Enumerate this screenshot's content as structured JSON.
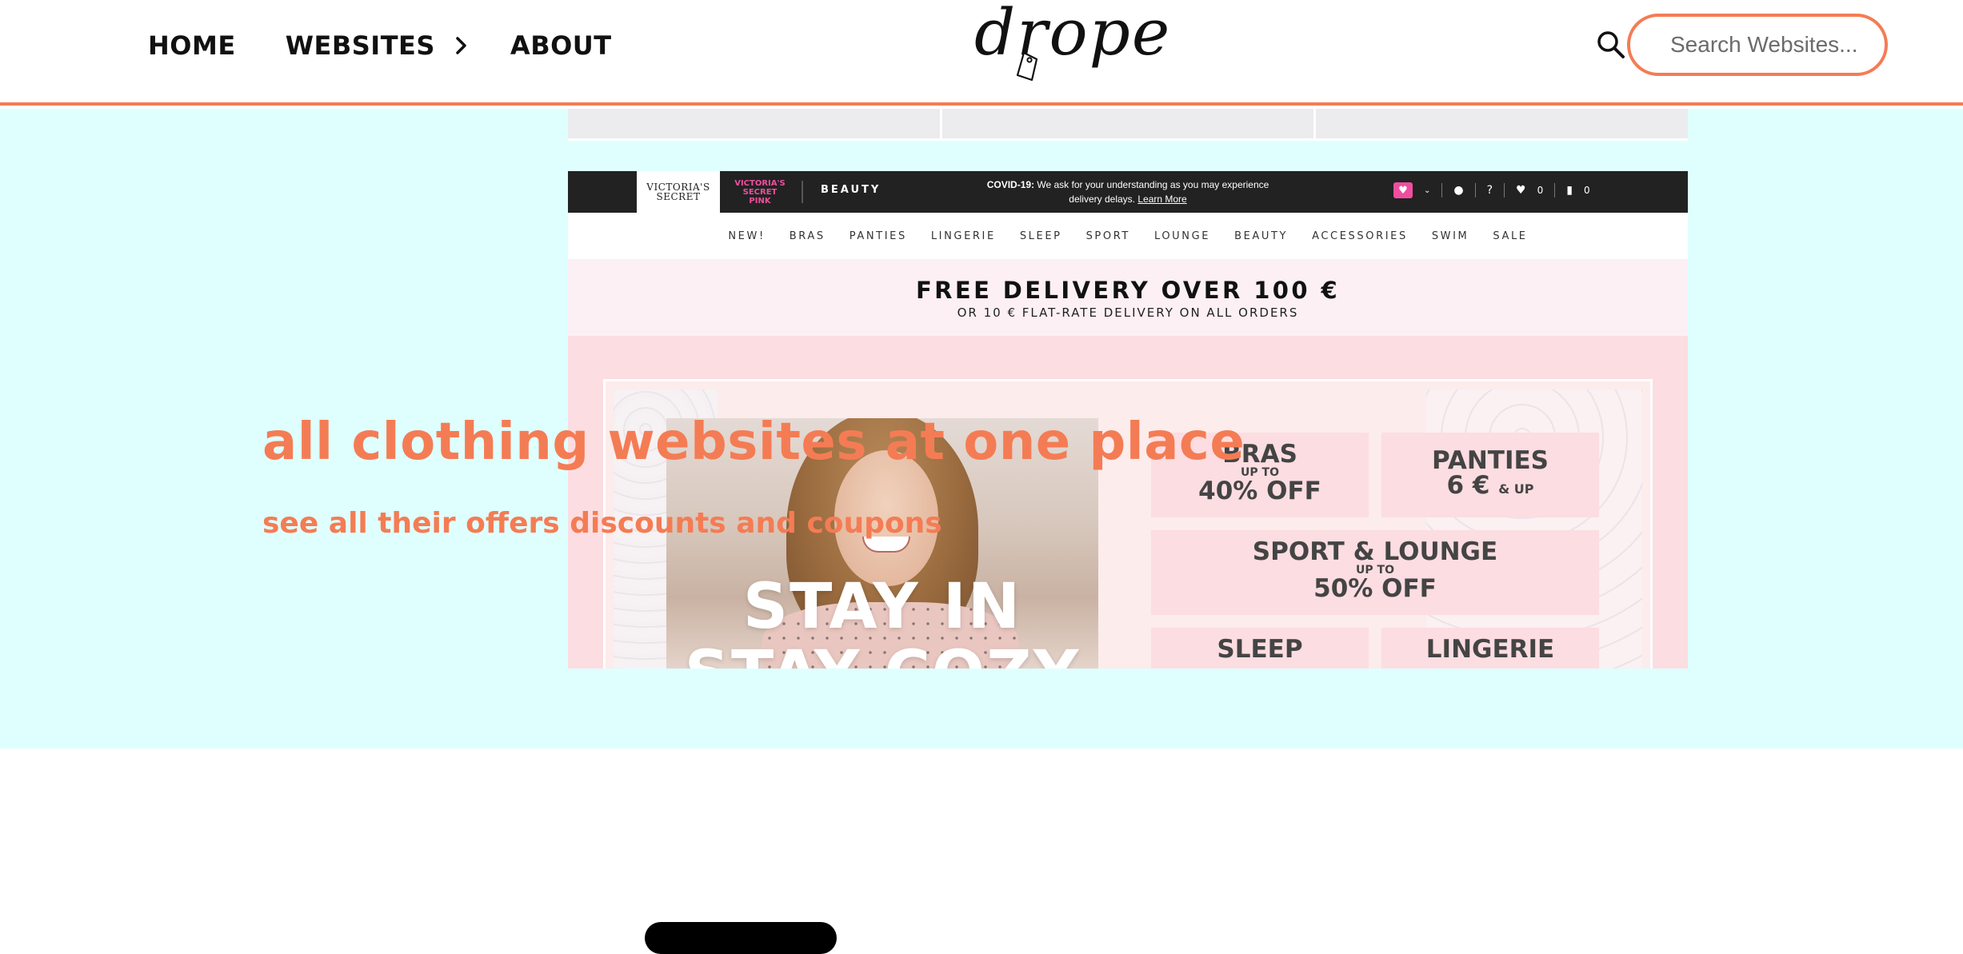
{
  "header": {
    "nav": {
      "home": "HOME",
      "websites": "WEBSITES",
      "about": "ABOUT"
    },
    "logo_text": "drope",
    "search": {
      "placeholder": "Search Websites..."
    }
  },
  "hero": {
    "title": "all clothing websites at one place",
    "subtitle": "see all their offers discounts and coupons",
    "background_color": "#dfffff",
    "accent_color": "#f47c54"
  },
  "preview": {
    "brand_logo_line1": "VICTORIA'S",
    "brand_logo_line2": "SECRET",
    "pink_line1": "VICTORIA'S",
    "pink_line2": "SECRET",
    "pink_line3": "PINK",
    "beauty": "BEAUTY",
    "covid_bold": "COVID-19:",
    "covid_text": "We ask for your understanding as you may experience",
    "covid_text2": "delivery delays.",
    "covid_link": "Learn More",
    "wishlist_count": "0",
    "bag_count": "0",
    "help": "?",
    "menu": [
      "NEW!",
      "BRAS",
      "PANTIES",
      "LINGERIE",
      "SLEEP",
      "SPORT",
      "LOUNGE",
      "BEAUTY",
      "ACCESSORIES",
      "SWIM",
      "SALE"
    ],
    "promo_main": "FREE DELIVERY OVER 100 €",
    "promo_sub": "OR 10 € FLAT-RATE DELIVERY ON ALL ORDERS",
    "banner_text_1": "STAY IN",
    "banner_text_2": "STAY COZY",
    "tiles": {
      "bras_title": "BRAS",
      "bras_small": "UP TO",
      "bras_offer": "40% OFF",
      "panties_title": "PANTIES",
      "panties_price": "6 €",
      "panties_small": "& UP",
      "sport_title": "SPORT & LOUNGE",
      "sport_small": "UP TO",
      "sport_offer": "50% OFF",
      "sleep_title": "SLEEP",
      "lingerie_title": "LINGERIE"
    }
  }
}
